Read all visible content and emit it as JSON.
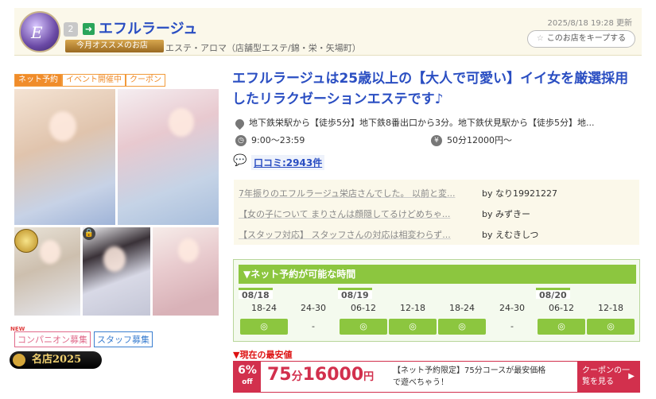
{
  "header": {
    "logo_text": "E",
    "rank": "2",
    "shop_name": "エフルラージュ",
    "badge": "今月オススメのお店",
    "category": "エステ・アロマ（店舗型エステ/錦・栄・矢場町）",
    "updated": "2025/8/18 19:28 更新",
    "keep_label": "このお店をキープする"
  },
  "tags": [
    "ネット予約",
    "イベント開催中",
    "クーポン"
  ],
  "recruit": {
    "companion": "コンパニオン募集",
    "staff": "スタッフ募集",
    "meiten": "名店2025"
  },
  "main": {
    "title": "エフルラージュは25歳以上の【大人で可愛い】イイ女を厳選採用したリラクゼーションエステです♪",
    "access": "地下鉄栄駅から【徒歩5分】地下鉄8番出口から3分。地下鉄伏見駅から【徒歩5分】地...",
    "hours": "9:00〜23:59",
    "price": "50分12000円〜",
    "reviews_link": "口コミ:2943件"
  },
  "reviews": [
    {
      "text": "7年振りのエフルラージュ栄店さんでした。 以前と変...",
      "by": "by なり19921227"
    },
    {
      "text": "【女の子について まりさんは顔隠してるけどめちゃ...",
      "by": "by みずきー"
    },
    {
      "text": "【スタッフ対応】 スタッフさんの対応は相変わらず...",
      "by": "by えむきしつ"
    }
  ],
  "reservation": {
    "heading": "▼ネット予約が可能な時間",
    "dates": [
      "08/18",
      "08/19",
      "08/20"
    ],
    "slots": [
      {
        "time": "18-24",
        "mark": "◎"
      },
      {
        "time": "24-30",
        "mark": "-"
      },
      {
        "time": "06-12",
        "mark": "◎"
      },
      {
        "time": "12-18",
        "mark": "◎"
      },
      {
        "time": "18-24",
        "mark": "◎"
      },
      {
        "time": "24-30",
        "mark": "-"
      },
      {
        "time": "06-12",
        "mark": "◎"
      },
      {
        "time": "12-18",
        "mark": "◎"
      }
    ]
  },
  "lowest_price": {
    "label": "▼現在の最安値",
    "percent": "6",
    "percent_unit": "%",
    "off": "off",
    "minutes": "75",
    "minutes_unit": "分",
    "amount": "16000",
    "yen": "円",
    "note": "【ネット予約限定】75分コースが最安価格で遊べちゃう！",
    "coupon_button": "クーポンの一覧を見る"
  },
  "colors": {
    "accent": "#2a4ec2",
    "net_tag": "#f08c2a",
    "green": "#8cc63f",
    "red": "#d2304d"
  }
}
